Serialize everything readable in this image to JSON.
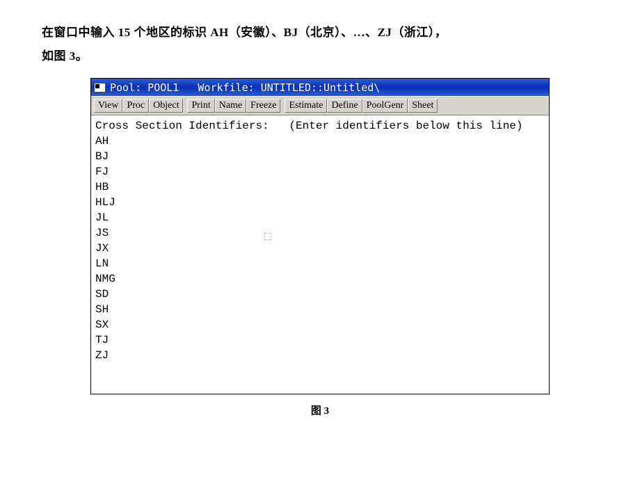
{
  "intro": {
    "line1": "在窗口中输入 15 个地区的标识 AH（安徽）、BJ（北京）、…、ZJ（浙江），",
    "line2": "如图 3。"
  },
  "window": {
    "title": "Pool: POOL1   Workfile: UNTITLED::Untitled\\"
  },
  "toolbar": {
    "group1": [
      "View",
      "Proc",
      "Object"
    ],
    "group2": [
      "Print",
      "Name",
      "Freeze"
    ],
    "group3": [
      "Estimate",
      "Define",
      "PoolGenr",
      "Sheet"
    ]
  },
  "content": {
    "header": "Cross Section Identifiers:   (Enter identifiers below this line)",
    "identifiers": [
      "AH",
      "BJ",
      "FJ",
      "HB",
      "HLJ",
      "JL",
      "JS",
      "JX",
      "LN",
      "NMG",
      "SD",
      "SH",
      "SX",
      "TJ",
      "ZJ"
    ]
  },
  "caption": "图 3"
}
